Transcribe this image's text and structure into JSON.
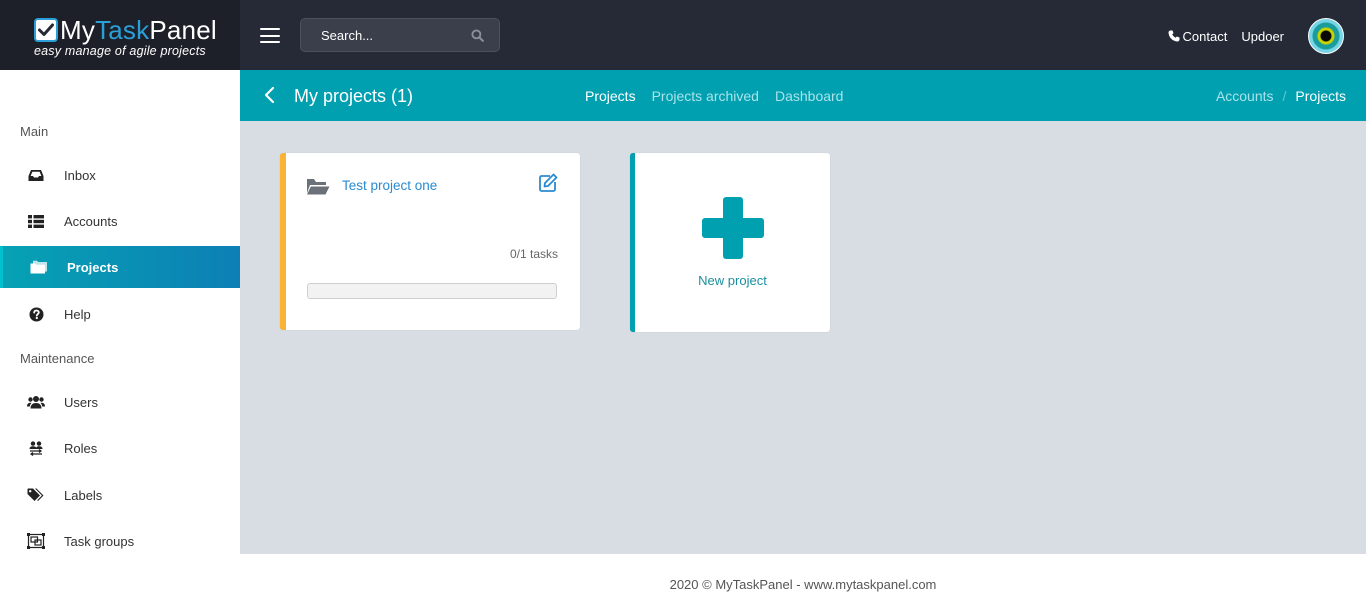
{
  "brand": {
    "logo_my": "My",
    "logo_task": "Task",
    "logo_panel": "Panel",
    "tagline": "easy manage of agile projects"
  },
  "search": {
    "placeholder": "Search..."
  },
  "header": {
    "contact": "Contact",
    "username": "Updoer"
  },
  "subheader": {
    "title": "My projects (1)",
    "tabs": [
      {
        "label": "Projects"
      },
      {
        "label": "Projects archived"
      },
      {
        "label": "Dashboard"
      }
    ],
    "breadcrumb": [
      "Accounts",
      "/",
      "Projects"
    ]
  },
  "sidebar": {
    "sections": [
      "Main",
      "Maintenance"
    ],
    "items": [
      {
        "label": "Inbox",
        "icon": "inbox-icon"
      },
      {
        "label": "Accounts",
        "icon": "list-icon"
      },
      {
        "label": "Projects",
        "icon": "folder-icon"
      },
      {
        "label": "Help",
        "icon": "question-circle-icon"
      },
      {
        "label": "Users",
        "icon": "users-icon"
      },
      {
        "label": "Roles",
        "icon": "roles-icon"
      },
      {
        "label": "Labels",
        "icon": "tags-icon"
      },
      {
        "label": "Task groups",
        "icon": "object-group-icon"
      }
    ]
  },
  "projects": [
    {
      "name": "Test project one",
      "tasks": "0/1 tasks",
      "progress": 0,
      "accent": "#fbb335"
    }
  ],
  "new_project": {
    "label": "New project"
  },
  "footer": {
    "text": "2020 © MyTaskPanel - www.mytaskpanel.com"
  },
  "colors": {
    "accent": "#00a0b0",
    "topbar": "#252a36",
    "link": "#2a8bd0"
  }
}
